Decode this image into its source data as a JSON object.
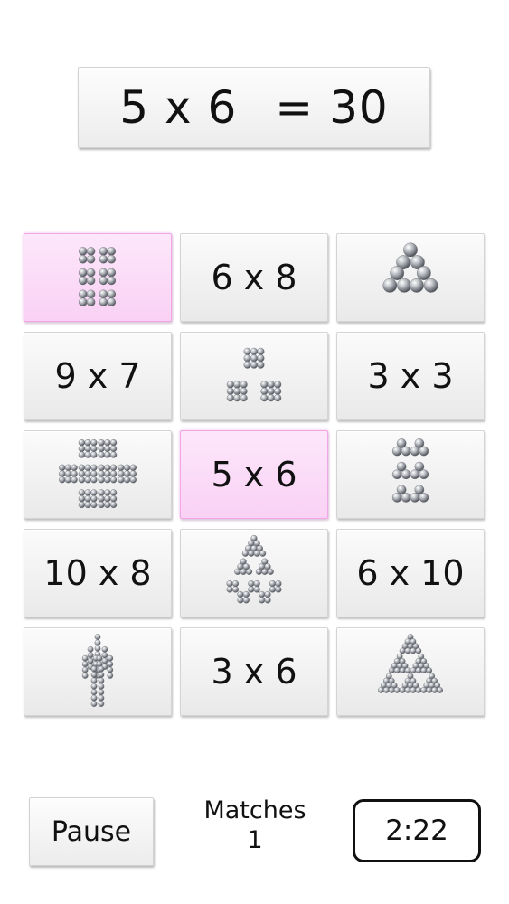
{
  "equation": {
    "left": "5 x 6",
    "right": "= 30"
  },
  "board": {
    "cards": [
      {
        "id": "r1c1",
        "type": "balls",
        "pattern": "rect-groups-2x2",
        "selected": true
      },
      {
        "id": "r1c2",
        "type": "text",
        "label": "6 x 8",
        "selected": false
      },
      {
        "id": "r1c3",
        "type": "balls",
        "pattern": "triangle-of-triangles",
        "selected": false
      },
      {
        "id": "r2c1",
        "type": "text",
        "label": "9 x 7",
        "selected": false
      },
      {
        "id": "r2c2",
        "type": "balls",
        "pattern": "three-squares-3x3",
        "selected": false
      },
      {
        "id": "r2c3",
        "type": "text",
        "label": "3 x 3",
        "selected": false
      },
      {
        "id": "r3c1",
        "type": "balls",
        "pattern": "cross-squares-3x3",
        "selected": false
      },
      {
        "id": "r3c2",
        "type": "text",
        "label": "5 x 6",
        "selected": true
      },
      {
        "id": "r3c3",
        "type": "balls",
        "pattern": "triangles-column",
        "selected": false
      },
      {
        "id": "r4c1",
        "type": "text",
        "label": "10 x 8",
        "selected": false
      },
      {
        "id": "r4c2",
        "type": "balls",
        "pattern": "triangle-stack",
        "selected": false
      },
      {
        "id": "r4c3",
        "type": "text",
        "label": "6 x 10",
        "selected": false
      },
      {
        "id": "r5c1",
        "type": "balls",
        "pattern": "tower-shape",
        "selected": false
      },
      {
        "id": "r5c2",
        "type": "text",
        "label": "3 x 6",
        "selected": false
      },
      {
        "id": "r5c3",
        "type": "balls",
        "pattern": "sierpinski-triangle",
        "selected": false
      }
    ]
  },
  "controls": {
    "pause_label": "Pause",
    "matches_label": "Matches",
    "matches_count": "1",
    "timer": "2:22"
  },
  "colors": {
    "selected_card": "#fbdbf6",
    "ball": "#8c8f96"
  }
}
